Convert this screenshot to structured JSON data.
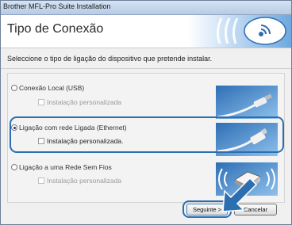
{
  "window": {
    "title": "Brother MFL-Pro Suite Installation"
  },
  "header": {
    "title": "Tipo de Conexão"
  },
  "instruction": "Seleccione o tipo de ligação do dispositivo que pretende instalar.",
  "options": [
    {
      "label": "Conexão Local (USB)",
      "selected": false,
      "custom_label": "Instalação personalizada",
      "custom_enabled": false,
      "icon": "usb-cable-icon"
    },
    {
      "label": "Ligação com rede Ligada (Ethernet)",
      "selected": true,
      "custom_label": "Instalação personalizada.",
      "custom_enabled": true,
      "icon": "ethernet-cable-icon"
    },
    {
      "label": "Ligação a uma Rede Sem Fios",
      "selected": false,
      "custom_label": "Instalação personalizada",
      "custom_enabled": false,
      "icon": "wireless-printer-icon"
    }
  ],
  "buttons": {
    "next": "Seguinte >",
    "cancel": "Cancelar"
  },
  "colors": {
    "highlight": "#2b6fb1",
    "brand": "#1f5fa8"
  }
}
